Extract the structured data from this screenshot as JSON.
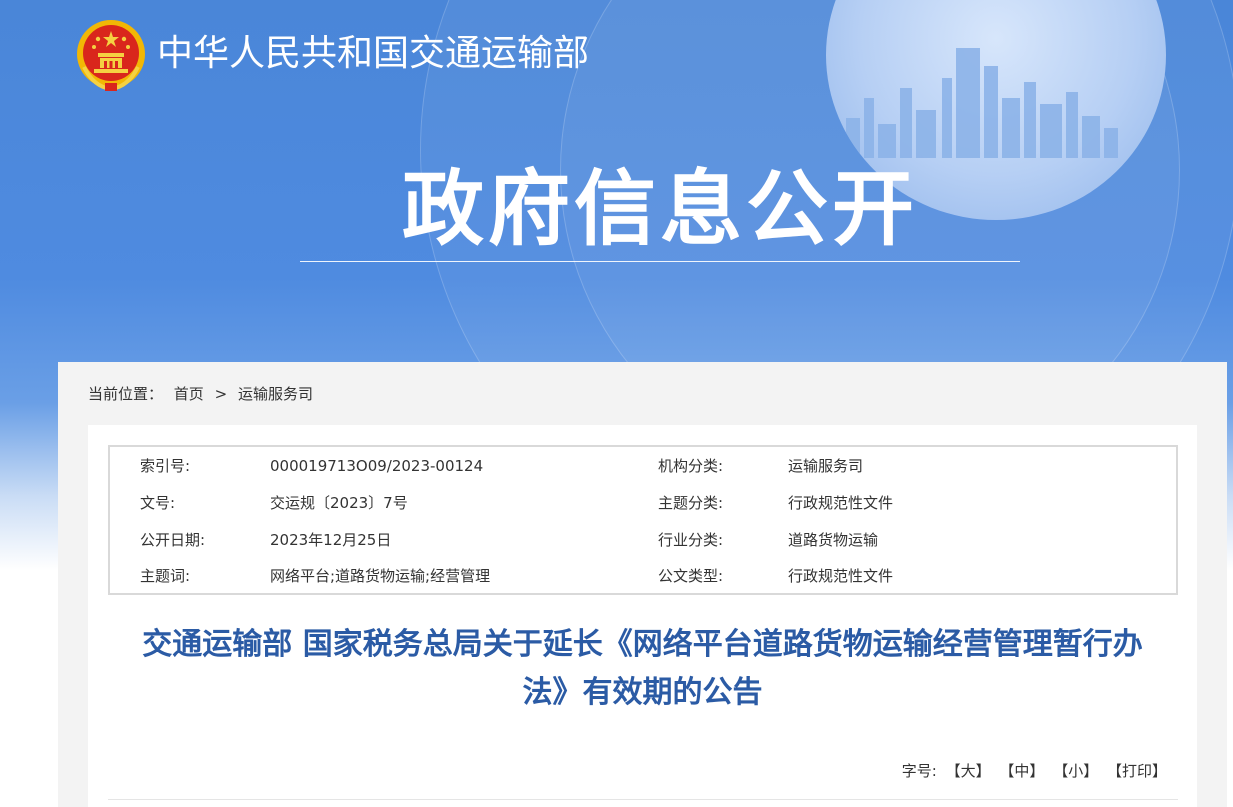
{
  "header": {
    "ministry_name": "中华人民共和国交通运输部",
    "banner_title": "政府信息公开"
  },
  "breadcrumb": {
    "prefix": "当前位置：",
    "items": [
      "首页",
      "运输服务司"
    ],
    "separator": ">"
  },
  "meta": {
    "rows": [
      {
        "k1": "索引号:",
        "v1": "000019713O09/2023-00124",
        "k2": "机构分类:",
        "v2": "运输服务司"
      },
      {
        "k1": "文号:",
        "v1": "交运规〔2023〕7号",
        "k2": "主题分类:",
        "v2": "行政规范性文件"
      },
      {
        "k1": "公开日期:",
        "v1": "2023年12月25日",
        "k2": "行业分类:",
        "v2": "道路货物运输"
      },
      {
        "k1": "主题词:",
        "v1": "网络平台;道路货物运输;经营管理",
        "k2": "公文类型:",
        "v2": "行政规范性文件"
      }
    ]
  },
  "document": {
    "title_line1": "交通运输部 国家税务总局关于延长《网络平台道路货物运输经营管理暂行办",
    "title_line2": "法》有效期的公告"
  },
  "font_size": {
    "label": "字号:",
    "large": "【大】",
    "medium": "【中】",
    "small": "【小】",
    "print": "【打印】"
  },
  "colors": {
    "banner_blue": "#4a86d8",
    "title_blue": "#2b5ba5",
    "emblem_red": "#d9261c",
    "emblem_gold": "#f5c542"
  }
}
